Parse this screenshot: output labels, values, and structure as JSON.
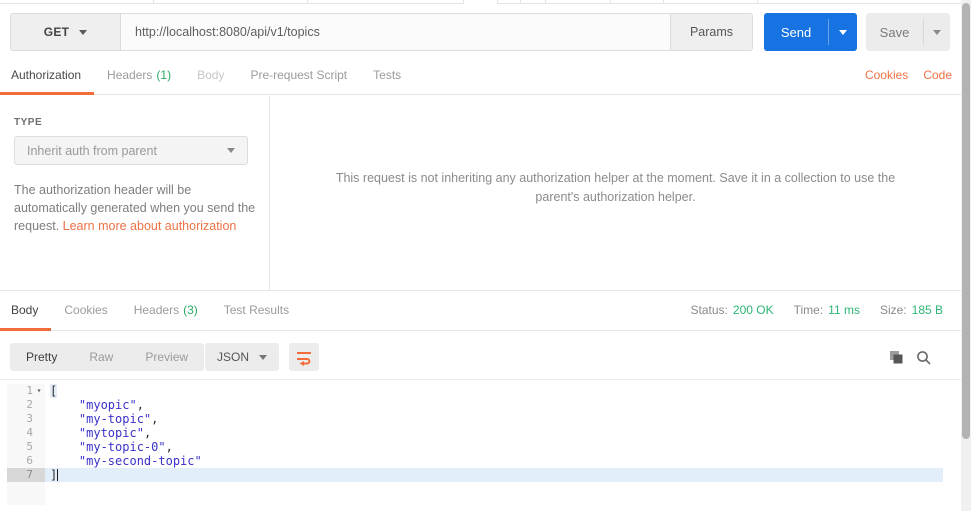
{
  "request": {
    "method": "GET",
    "url": "http://localhost:8080/api/v1/topics",
    "params_label": "Params",
    "send_label": "Send",
    "save_label": "Save",
    "tabs": [
      {
        "label": "Authorization",
        "active": true
      },
      {
        "label": "Headers",
        "count": "(1)"
      },
      {
        "label": "Body",
        "disabled": true
      },
      {
        "label": "Pre-request Script"
      },
      {
        "label": "Tests"
      }
    ],
    "links": {
      "cookies": "Cookies",
      "code": "Code"
    }
  },
  "authorization": {
    "type_label": "TYPE",
    "type_value": "Inherit auth from parent",
    "description": "The authorization header will be automatically generated when you send the request. ",
    "learn_more_link": "Learn more about authorization",
    "notice": "This request is not inheriting any authorization helper at the moment. Save it in a collection to use the parent's authorization helper."
  },
  "response": {
    "tabs": [
      {
        "label": "Body",
        "active": true
      },
      {
        "label": "Cookies"
      },
      {
        "label": "Headers",
        "count": "(3)"
      },
      {
        "label": "Test Results"
      }
    ],
    "meta": [
      {
        "label": "Status:",
        "value": "200 OK"
      },
      {
        "label": "Time:",
        "value": "11 ms"
      },
      {
        "label": "Size:",
        "value": "185 B"
      }
    ],
    "view_modes": [
      {
        "label": "Pretty",
        "active": true
      },
      {
        "label": "Raw"
      },
      {
        "label": "Preview"
      }
    ],
    "format": "JSON",
    "accent_color": "#f26b3a",
    "status_color": "#2bb673",
    "body_lines": [
      {
        "num": "1",
        "indent": 0,
        "str": "",
        "punct": "[",
        "fold": true,
        "bracket": true
      },
      {
        "num": "2",
        "indent": 1,
        "str": "\"myopic\"",
        "punct": ","
      },
      {
        "num": "3",
        "indent": 1,
        "str": "\"my-topic\"",
        "punct": ","
      },
      {
        "num": "4",
        "indent": 1,
        "str": "\"mytopic\"",
        "punct": ","
      },
      {
        "num": "5",
        "indent": 1,
        "str": "\"my-topic-0\"",
        "punct": ","
      },
      {
        "num": "6",
        "indent": 1,
        "str": "\"my-second-topic\"",
        "punct": ""
      },
      {
        "num": "7",
        "indent": 0,
        "str": "",
        "punct": "]",
        "active": true,
        "cursor": true
      }
    ]
  }
}
